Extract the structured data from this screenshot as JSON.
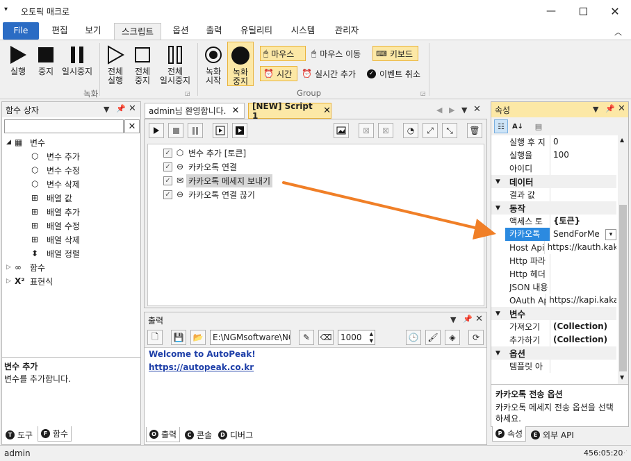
{
  "app": {
    "title": "오토픽 매크로"
  },
  "ribbon_tabs": [
    {
      "label": "File"
    },
    {
      "label": "편집"
    },
    {
      "label": "보기"
    },
    {
      "label": "스크립트"
    },
    {
      "label": "옵션"
    },
    {
      "label": "출력"
    },
    {
      "label": "유틸리티"
    },
    {
      "label": "시스템"
    },
    {
      "label": "관리자"
    }
  ],
  "ribbon": {
    "run": "실행",
    "stop": "중지",
    "pause": "일시중지",
    "run_all_1": "전체",
    "run_all_2": "실행",
    "stop_all_1": "전체",
    "stop_all_2": "중지",
    "pause_all_1": "전체",
    "pause_all_2": "일시중지",
    "record_group": "녹화",
    "rec_start_1": "녹화",
    "rec_start_2": "시작",
    "rec_stop_1": "녹화",
    "rec_stop_2": "중지",
    "mouse": "마우스",
    "mouse_move": "마우스 이동",
    "keyboard": "키보드",
    "time": "시간",
    "realtime_add": "실시간 추가",
    "event_cancel": "이벤트 취소",
    "group_label": "Group"
  },
  "left_panel": {
    "title": "함수 상자",
    "search_value": "",
    "tree": {
      "variables": "변수",
      "var_items": [
        "변수 추가",
        "변수 수정",
        "변수 삭제",
        "배열 값",
        "배열 추가",
        "배열 수정",
        "배열 삭제",
        "배열 정렬"
      ],
      "functions": "함수",
      "expressions": "표현식"
    },
    "desc_title": "변수 추가",
    "desc_text": "변수를 추가합니다.",
    "bottom_tabs": {
      "tools": "도구",
      "functions": "함수",
      "tools_key": "T",
      "functions_key": "F"
    }
  },
  "doc_tabs": [
    {
      "label": "admin님 환영합니다."
    },
    {
      "label": "[NEW] Script 1"
    }
  ],
  "script_lines": [
    {
      "text": "변수 추가 [토큰]",
      "checked": true,
      "icon": "cube-icon"
    },
    {
      "text": "카카오톡 연결",
      "checked": true,
      "icon": "link-icon"
    },
    {
      "text": "카카오톡 메세지 보내기",
      "checked": true,
      "icon": "mail-icon",
      "selected": true
    },
    {
      "text": "카카오톡 연결 끊기",
      "checked": true,
      "icon": "link-icon"
    }
  ],
  "output": {
    "title": "출력",
    "path": "E:\\NGMsoftware\\NG",
    "delay": "1000",
    "lines": [
      "Welcome to AutoPeak!",
      "https://autopeak.co.kr"
    ],
    "tabs": {
      "output": "출력",
      "console": "콘솔",
      "debug": "디버그",
      "output_key": "O",
      "console_key": "C",
      "debug_key": "D"
    }
  },
  "props": {
    "title": "속성",
    "rows_top": [
      {
        "name": "실행 후 지",
        "value": "0"
      },
      {
        "name": "실행율",
        "value": "100"
      },
      {
        "name": "아이디",
        "value": ""
      }
    ],
    "cat_data": "데이터",
    "row_result": {
      "name": "결과 값",
      "value": ""
    },
    "cat_action": "동작",
    "row_token": {
      "name": "액세스 토",
      "value": "{토큰}"
    },
    "row_kakao": {
      "name": "카카오톡",
      "value": "SendForMe"
    },
    "rows_action": [
      {
        "name": "Host Api",
        "value": "https://kauth.kakao"
      },
      {
        "name": "Http 파라",
        "value": ""
      },
      {
        "name": "Http 헤더",
        "value": ""
      },
      {
        "name": "JSON 내용",
        "value": ""
      },
      {
        "name": "OAuth Ap",
        "value": "https://kapi.kakao"
      }
    ],
    "cat_var": "변수",
    "rows_var": [
      {
        "name": "가져오기",
        "value": "(Collection)"
      },
      {
        "name": "추가하기",
        "value": "(Collection)"
      }
    ],
    "cat_opt": "옵션",
    "row_template": {
      "name": "템플릿 아",
      "value": ""
    },
    "desc_title": "카카오톡 전송 옵션",
    "desc_text_1": "카카오톡 메세지 전송 옵션을 선택",
    "desc_text_2": "하세요.",
    "bottom_tabs": {
      "props": "속성",
      "external": "외부 API",
      "props_key": "P",
      "external_key": "E"
    }
  },
  "status": {
    "user": "admin",
    "time": "456:05:20"
  },
  "colors": {
    "accent": "#2b6cc4",
    "highlight": "#fce8a6",
    "arrow": "#f07f27",
    "link": "#1e3fa8"
  }
}
